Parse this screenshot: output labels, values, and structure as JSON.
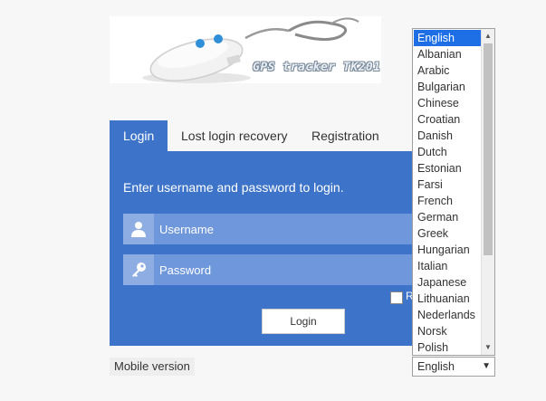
{
  "banner": {
    "caption": "GPS tracker TK201"
  },
  "tabs": [
    {
      "label": "Login",
      "active": true
    },
    {
      "label": "Lost login recovery",
      "active": false
    },
    {
      "label": "Registration",
      "active": false
    }
  ],
  "login": {
    "intro": "Enter username and password to login.",
    "username_placeholder": "Username",
    "password_placeholder": "Password",
    "remember_label": "R",
    "button_label": "Login"
  },
  "footer": {
    "mobile_label": "Mobile version"
  },
  "language": {
    "selected": "English",
    "options": [
      "English",
      "Albanian",
      "Arabic",
      "Bulgarian",
      "Chinese",
      "Croatian",
      "Danish",
      "Dutch",
      "Estonian",
      "Farsi",
      "French",
      "German",
      "Greek",
      "Hungarian",
      "Italian",
      "Japanese",
      "Lithuanian",
      "Nederlands",
      "Norsk",
      "Polish"
    ]
  },
  "colors": {
    "accent": "#3d74c9",
    "field": "#6f97db",
    "selection": "#1e6fe6"
  }
}
